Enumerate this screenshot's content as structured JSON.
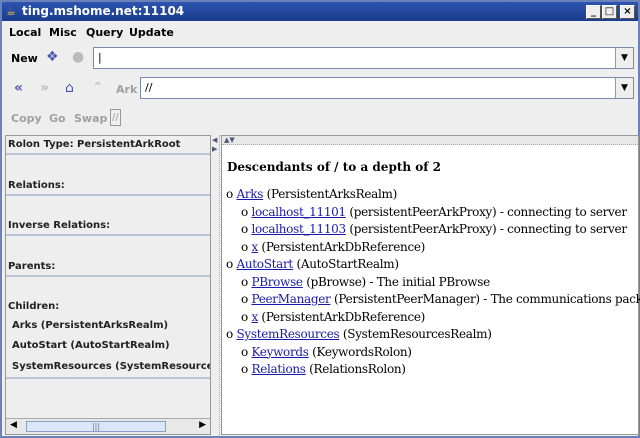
{
  "window": {
    "title": "ting.mshome.net:11104",
    "min": "_",
    "max": "□",
    "close": "×"
  },
  "menu": [
    "Local",
    "Misc",
    "Query",
    "Update"
  ],
  "toolbar1": {
    "new_label": "New",
    "input_value": ""
  },
  "toolbar2": {
    "ark_label": "Ark",
    "input_value": "//"
  },
  "toolbar3": {
    "copy": "Copy",
    "go": "Go",
    "swap": "Swap",
    "field_value": "//"
  },
  "left": {
    "rolon_type": "Rolon Type: PersistentArkRoot",
    "relations": "Relations:",
    "inverse_relations": "Inverse Relations:",
    "parents": "Parents:",
    "children": "Children:",
    "children_items": [
      "Arks (PersistentArksRealm)",
      "AutoStart (AutoStartRealm)",
      "SystemResources (SystemResourcesRealm)"
    ]
  },
  "right": {
    "heading": "Descendants of / to a depth of 2",
    "tree": [
      {
        "depth": 1,
        "link": "Arks",
        "text": " (PersistentArksRealm)"
      },
      {
        "depth": 2,
        "link": "localhost_11101",
        "text": " (persistentPeerArkProxy) - connecting to server"
      },
      {
        "depth": 2,
        "link": "localhost_11103",
        "text": " (persistentPeerArkProxy) - connecting to server"
      },
      {
        "depth": 2,
        "link": "x",
        "text": " (PersistentArkDbReference)"
      },
      {
        "depth": 1,
        "link": "AutoStart",
        "text": " (AutoStartRealm)"
      },
      {
        "depth": 2,
        "link": "PBrowse",
        "text": " (pBrowse) - The initial PBrowse"
      },
      {
        "depth": 2,
        "link": "PeerManager",
        "text": " (PersistentPeerManager) - The communications package"
      },
      {
        "depth": 2,
        "link": "x",
        "text": " (PersistentArkDbReference)"
      },
      {
        "depth": 1,
        "link": "SystemResources",
        "text": " (SystemResourcesRealm)"
      },
      {
        "depth": 2,
        "link": "Keywords",
        "text": " (KeywordsRolon)"
      },
      {
        "depth": 2,
        "link": "Relations",
        "text": " (RelationsRolon)"
      }
    ],
    "bullet": "o"
  }
}
